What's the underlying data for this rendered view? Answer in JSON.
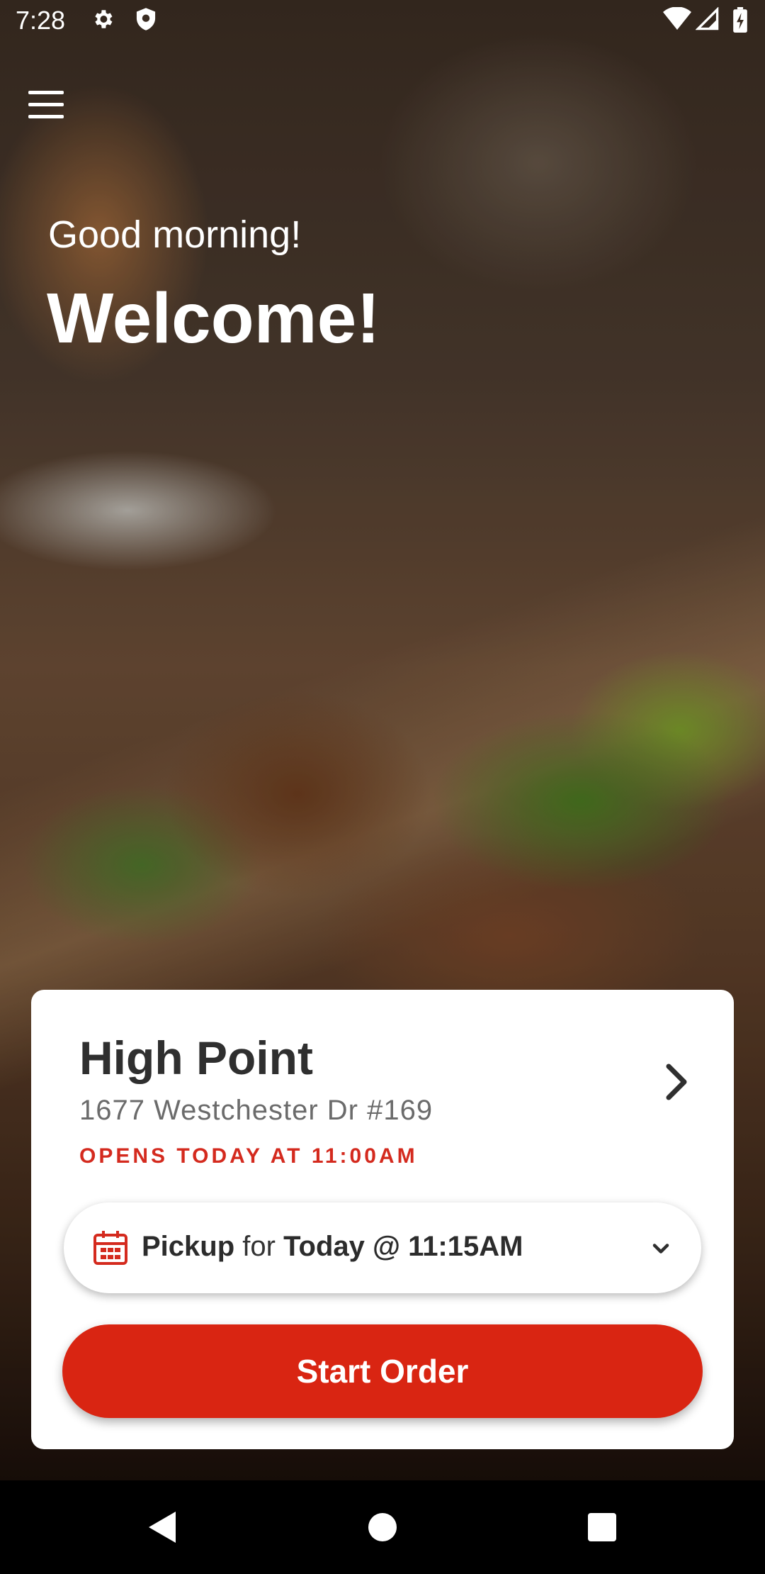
{
  "status_bar": {
    "time": "7:28",
    "icons": [
      "settings-gear-icon",
      "shield-icon",
      "wifi-icon",
      "signal-icon",
      "battery-icon"
    ]
  },
  "hero": {
    "greeting": "Good morning!",
    "welcome": "Welcome!"
  },
  "store": {
    "name": "High Point",
    "address": "1677 Westchester Dr #169",
    "hours_status": "OPENS TODAY AT 11:00AM"
  },
  "pickup": {
    "mode": "Pickup",
    "connector": "for",
    "time": "Today @ 11:15AM"
  },
  "actions": {
    "start_order": "Start Order"
  },
  "colors": {
    "accent": "#d92512",
    "hours_text": "#d42a1e",
    "card_bg": "#ffffff"
  },
  "nav_bar": {
    "buttons": [
      "back-icon",
      "home-icon",
      "recents-icon"
    ]
  }
}
